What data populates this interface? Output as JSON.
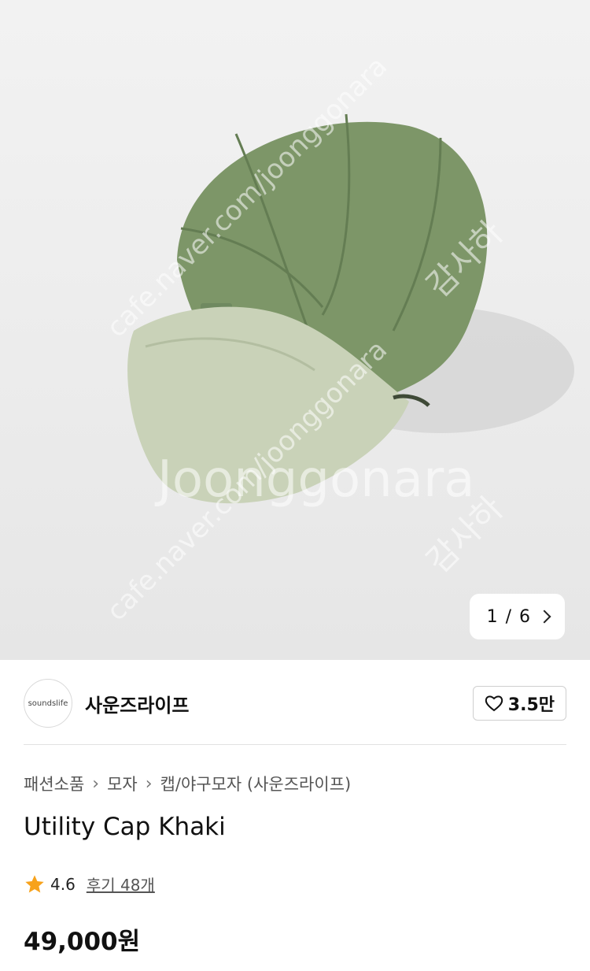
{
  "gallery": {
    "image_alt": "Utility Cap Khaki",
    "current_index": "1",
    "separator": "/",
    "total": "6",
    "watermarks": [
      "joonggonara",
      "cafe.naver.com/joonggonara",
      "감사하"
    ]
  },
  "seller": {
    "avatar_text": "soundslife",
    "name": "사운즈라이프",
    "like_count": "3.5만"
  },
  "breadcrumb": [
    "패션소품",
    "모자",
    "캡/야구모자 (사운즈라이프)"
  ],
  "product": {
    "title": "Utility Cap Khaki",
    "rating": "4.6",
    "reviews_label": "후기 48개",
    "price": "49,000원"
  },
  "colors": {
    "star": "#F7A21B",
    "cap_crown": "#7d9668",
    "cap_brim": "#c9d2b8"
  }
}
